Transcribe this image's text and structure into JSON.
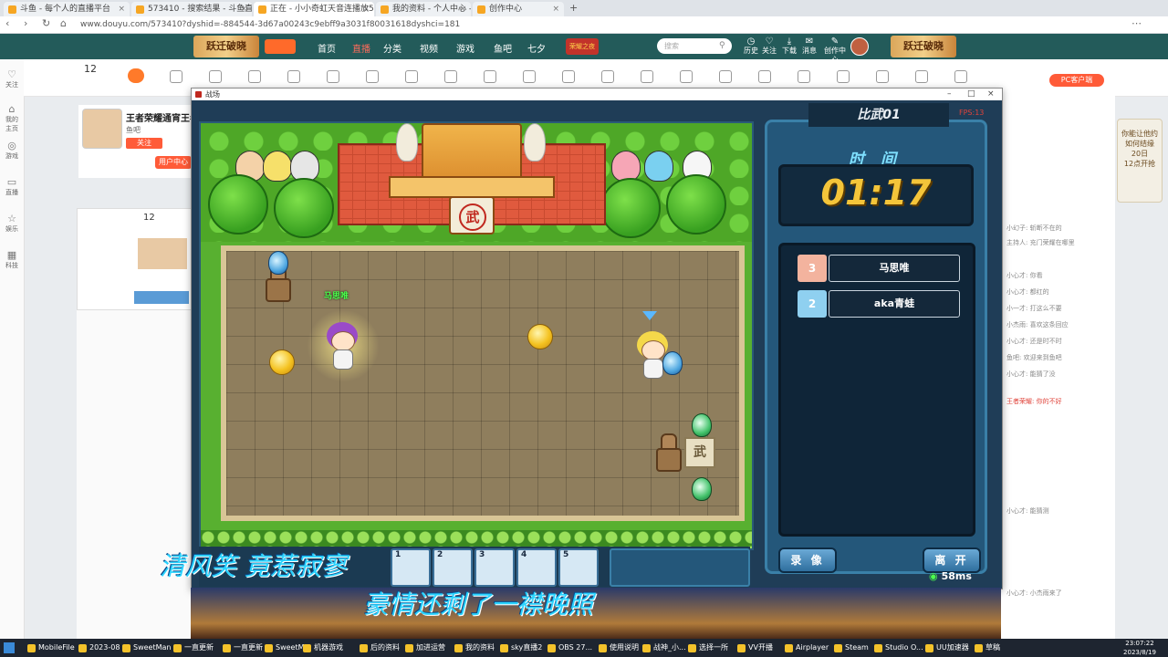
{
  "browser": {
    "tabs": [
      {
        "label": "斗鱼 - 每个人的直播平台",
        "active": false
      },
      {
        "label": "573410 - 搜索结果 - 斗鱼直播",
        "active": false
      },
      {
        "label": "正在 - 小小奇虹天音连播放573410",
        "active": true
      },
      {
        "label": "我的资料 - 个人中心 - 斗鱼",
        "active": false
      },
      {
        "label": "创作中心",
        "active": false
      }
    ],
    "url": "www.douyu.com/573410?dyshid=-884544-3d67a00243c9ebff9a3031f80031618dyshci=181"
  },
  "site": {
    "logo_left": "跃迁破晓",
    "logo_right": "跃迁破晓",
    "nav": [
      "首页",
      "直播",
      "分类",
      "视频",
      "游戏",
      "鱼吧",
      "七夕"
    ],
    "nav_active_index": 1,
    "event_badge": "荣耀之夜",
    "search_placeholder": "搜索",
    "header_icons": [
      "历史",
      "关注",
      "下载",
      "消息",
      "创作中心"
    ],
    "pc_client": "PC客户端"
  },
  "left_rail": [
    "关注",
    "我的主页",
    "游戏",
    "直播",
    "娱乐",
    "科技"
  ],
  "streamer": {
    "title": "王者荣耀通宵王者",
    "name": "鱼吧",
    "follow": "关注",
    "count": "12",
    "tag": "用户中心"
  },
  "game": {
    "window_title": "战场",
    "room_label": "比武01",
    "fps": "FPS:13",
    "time_label": "时 间",
    "timer": "01:17",
    "players": [
      {
        "rank": "3",
        "name": "马思唯",
        "color": "#f3b39e"
      },
      {
        "rank": "2",
        "name": "aka青蛙",
        "color": "#8fd0f0"
      }
    ],
    "record_button": "录 像",
    "leave_button": "离 开",
    "ping": "58ms",
    "player_tag": "马思唯",
    "gate_char": "武",
    "stone_char": "武",
    "slots": [
      "1",
      "2",
      "3",
      "4",
      "5"
    ]
  },
  "overlay": {
    "lyric_line1": "清风笑 竟惹寂寥",
    "lyric_line2": "豪情还剩了一襟晚照"
  },
  "chat": {
    "lines": [
      "小幻子: 斩断不在的",
      "主持人: 充门荣耀在哪里",
      "小心才: 你看",
      "小心才: 都红的",
      "小一才: 打这么不要",
      "小杰雨: 喜欢这条回应",
      "小心才: 还是时不时",
      "鱼吧: 欢迎来到鱼吧",
      "小心才: 能猜了没",
      "王者荣耀: 你的不好",
      "小心才: 能猜测",
      "小心才: 小杰雨来了"
    ],
    "ad_title": "你能让他约",
    "ad_sub": "如何结缘",
    "ad_date": "20日",
    "ad_time": "12点开抢"
  },
  "taskbar": {
    "items": [
      "MobileFile",
      "2023-08",
      "SweetMan",
      "一直更新",
      "一直更新",
      "SweetMa",
      "机器游戏",
      "后的资料",
      "加进运营",
      "我的资料",
      "sky直播2",
      "OBS 27...",
      "使用说明",
      "战神_小...",
      "选择一所",
      "VV开播",
      "Airplayer",
      "Steam",
      "Studio O...",
      "UU加速器",
      "草稿"
    ],
    "time": "23:07:22",
    "date": "2023/8/19"
  }
}
